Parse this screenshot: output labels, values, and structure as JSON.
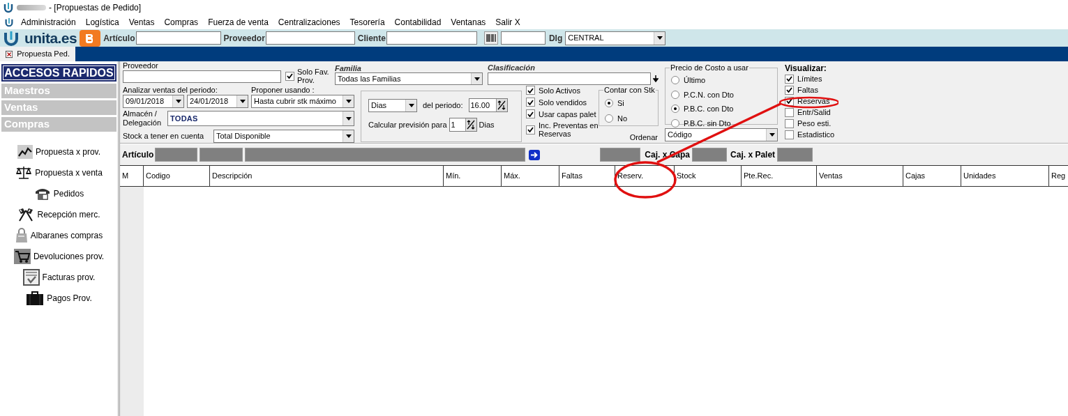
{
  "window": {
    "title": "- [Propuestas de Pedido]"
  },
  "menu": [
    "Administración",
    "Logística",
    "Ventas",
    "Compras",
    "Fuerza de venta",
    "Centralizaciones",
    "Tesorería",
    "Contabilidad",
    "Ventanas",
    "Salir X"
  ],
  "toolbar": {
    "logo": "unita.es",
    "fields": [
      {
        "label": "Artículo"
      },
      {
        "label": "Proveedor"
      },
      {
        "label": "Cliente"
      }
    ],
    "dlg": {
      "label": "Dlg",
      "value": "CENTRAL"
    }
  },
  "tabs": [
    {
      "label": "Propuesta Ped.",
      "selected": true
    }
  ],
  "sidebar": {
    "title": "ACCESOS RAPIDOS",
    "sections": [
      {
        "label": "Maestros"
      },
      {
        "label": "Ventas"
      },
      {
        "label": "Compras",
        "items": [
          {
            "label": "Propuesta x prov.",
            "kind": "chart"
          },
          {
            "label": "Propuesta x venta",
            "kind": "scale"
          },
          {
            "label": "Pedidos",
            "kind": "phone"
          },
          {
            "label": "Recepción merc.",
            "kind": "flags"
          },
          {
            "label": "Albaranes compras",
            "kind": "bag"
          },
          {
            "label": "Devoluciones prov.",
            "kind": "cart"
          },
          {
            "label": "Facturas prov.",
            "kind": "invoice"
          },
          {
            "label": "Pagos Prov.",
            "kind": "briefcase"
          }
        ]
      }
    ]
  },
  "filters": {
    "proveedor": {
      "label": "Proveedor"
    },
    "solo_fav": {
      "label": "Solo Fav. Prov.",
      "checked": true
    },
    "familia": {
      "label": "Familia",
      "value": "Todas las Familias"
    },
    "clasificacion": {
      "label": "Clasificación"
    },
    "periodo": {
      "label": "Analizar ventas del periodo:",
      "from": "09/01/2018",
      "to": "24/01/2018"
    },
    "proponer": {
      "label": "Proponer usando :",
      "value": "Hasta cubrir stk máximo"
    },
    "almacen": {
      "label": "Almacén / Delegación",
      "value": "TODAS"
    },
    "stock": {
      "label": "Stock a tener en cuenta",
      "value": "Total Disponible"
    },
    "prevision": {
      "unit": "Dias",
      "period_label": "del periodo:",
      "period_value": "16.00",
      "calc_label": "Calcular previsión para",
      "calc_value": "1",
      "calc_unit": "Dias"
    },
    "options": [
      {
        "label": "Solo Activos",
        "checked": true
      },
      {
        "label": "Solo vendidos",
        "checked": true
      },
      {
        "label": "Usar capas palet",
        "checked": true
      },
      {
        "label": "Inc. Preventas en Reservas",
        "checked": true
      }
    ],
    "contar": {
      "title": "Contar con Stk",
      "options": [
        {
          "label": "Si",
          "selected": true
        },
        {
          "label": "No",
          "selected": false
        }
      ]
    },
    "precio": {
      "title": "Precio de Costo a usar",
      "options": [
        {
          "label": "Último",
          "selected": false
        },
        {
          "label": "P.C.N. con Dto",
          "selected": false
        },
        {
          "label": "P.B.C. con Dto",
          "selected": true
        },
        {
          "label": "P.B.C. sin Dto",
          "selected": false
        }
      ]
    },
    "ordenar": {
      "label": "Ordenar",
      "value": "Código"
    },
    "visualizar": {
      "title": "Visualizar:",
      "options": [
        {
          "label": "Límites",
          "checked": true
        },
        {
          "label": "Faltas",
          "checked": true
        },
        {
          "label": "Reservas",
          "checked": true
        },
        {
          "label": "Entr/Salid",
          "checked": false
        },
        {
          "label": "Peso esti.",
          "checked": false
        },
        {
          "label": "Estadistico",
          "checked": false
        }
      ]
    }
  },
  "article_bar": {
    "label": "Artículo",
    "caj_capa": "Caj. x Capa",
    "caj_palet": "Caj. x Palet"
  },
  "table": {
    "columns": [
      "M",
      "Codigo",
      "Descripción",
      "Mín.",
      "Máx.",
      "Faltas",
      "Reserv.",
      "Stock",
      "Pte.Rec.",
      "Ventas",
      "Cajas",
      "Unidades",
      "Reg"
    ]
  }
}
